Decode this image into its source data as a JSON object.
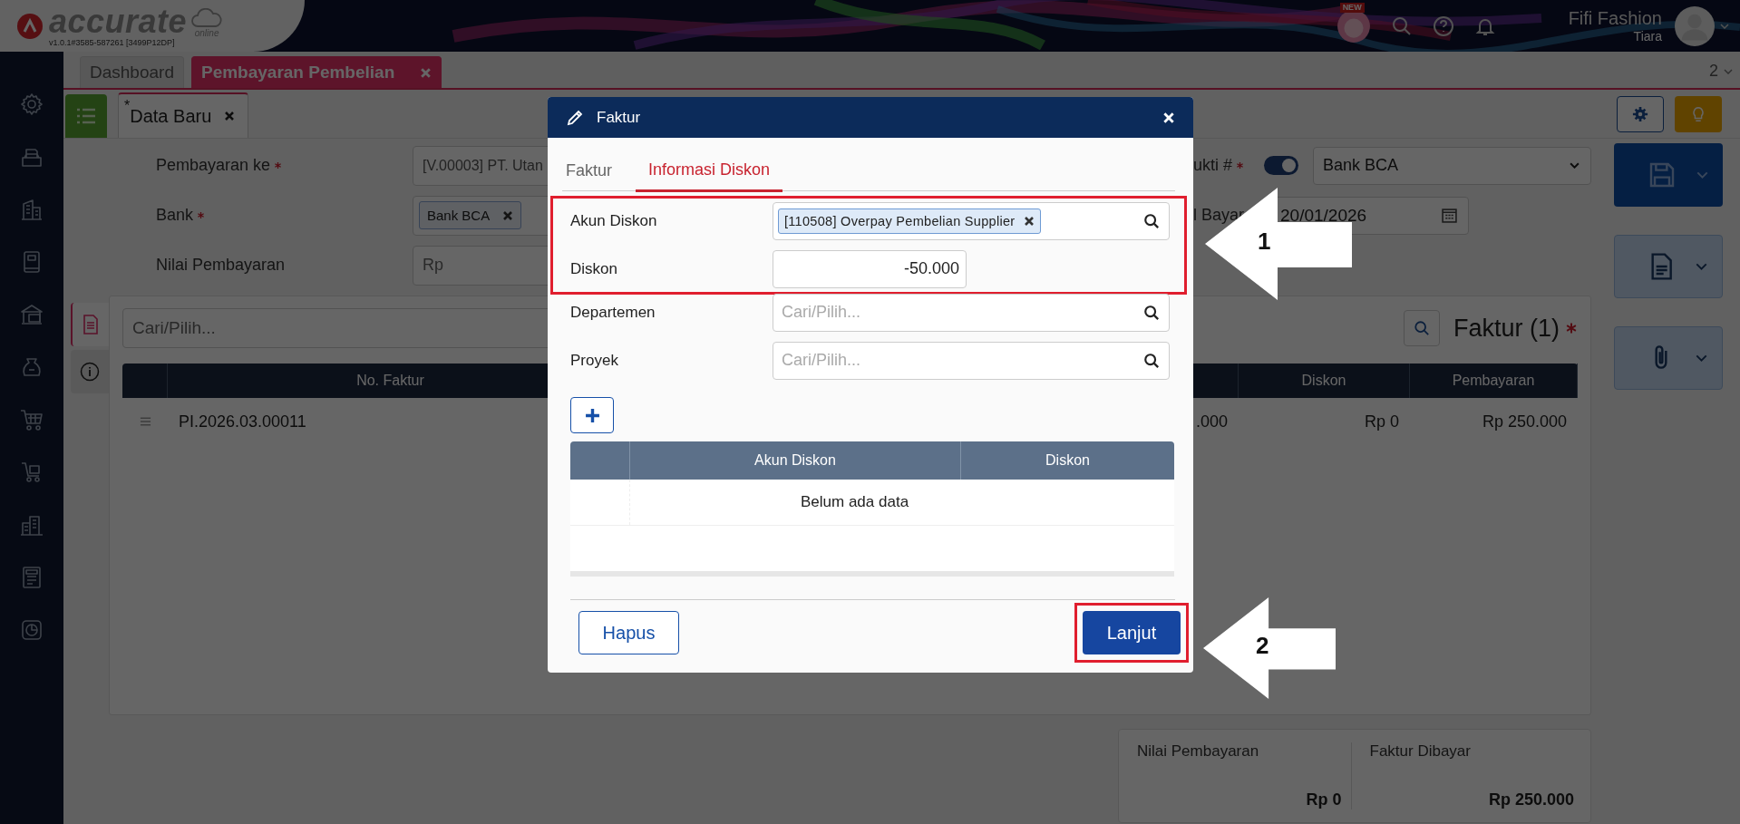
{
  "header": {
    "brand": "accurate",
    "brand_sub": "online",
    "version": "v1.0.1#3585-587261 [3499P12DP]",
    "badge": "NEW",
    "company": "Fifi Fashion",
    "user": "Tiara"
  },
  "tabs": [
    {
      "label": "Dashboard",
      "selected": false,
      "closable": false
    },
    {
      "label": "Pembayaran Pembelian",
      "selected": true,
      "closable": true
    }
  ],
  "tab_count": "2",
  "subtabs": [
    {
      "label": "Data Baru",
      "mark": "*",
      "selected": true
    }
  ],
  "form": {
    "fields": [
      {
        "label": "Pembayaran ke",
        "required": true,
        "kind": "text",
        "value": "[V.00003] PT. Utan"
      },
      {
        "label": "Bank",
        "required": true,
        "kind": "tag",
        "value": "Bank BCA"
      },
      {
        "label": "Nilai Pembayaran",
        "required": false,
        "kind": "text",
        "placeholder": "Rp"
      }
    ],
    "right": {
      "number_label": "ukti #",
      "number_required": true,
      "auto_number_on": true,
      "number_value": "Bank BCA",
      "date_label": "l Bayar",
      "date_value": "20/01/2026"
    }
  },
  "panel": {
    "side_tabs": [
      {
        "selected": true
      },
      {
        "selected": false
      }
    ],
    "search_placeholder": "Cari/Pilih...",
    "title": "Faktur (1)",
    "title_required": true,
    "table": {
      "columns": [
        "No. Faktur",
        "Diskon",
        "Pembayaran"
      ],
      "rows": [
        {
          "no_faktur": "PI.2026.03.00011",
          "column_3": ".000",
          "diskon": "Rp 0",
          "pembayaran": "Rp 250.000"
        }
      ]
    }
  },
  "summary": [
    {
      "label": "Nilai Pembayaran",
      "value": "Rp 0"
    },
    {
      "label": "Faktur Dibayar",
      "value": "Rp 250.000"
    }
  ],
  "modal": {
    "title": "Faktur",
    "tabs": [
      {
        "label": "Faktur",
        "selected": false
      },
      {
        "label": "Informasi Diskon",
        "selected": true
      }
    ],
    "field_groups": [
      {
        "highlighted": true,
        "fields": [
          {
            "label": "Akun Diskon",
            "kind": "tag",
            "value": "[110508] Overpay Pembelian Supplier"
          },
          {
            "label": "Diskon",
            "kind": "number",
            "value": "-50.000"
          }
        ]
      },
      {
        "highlighted": false,
        "fields": [
          {
            "label": "Departemen",
            "kind": "search",
            "placeholder": "Cari/Pilih..."
          },
          {
            "label": "Proyek",
            "kind": "search",
            "placeholder": "Cari/Pilih..."
          }
        ]
      }
    ],
    "table": {
      "columns": [
        "Akun Diskon",
        "Diskon"
      ],
      "empty_text": "Belum ada data"
    },
    "buttons": [
      {
        "label": "Hapus",
        "kind": "secondary",
        "highlighted": false
      },
      {
        "label": "Lanjut",
        "kind": "primary",
        "highlighted": true
      }
    ]
  },
  "annotations": [
    {
      "label": "1"
    },
    {
      "label": "2"
    }
  ]
}
